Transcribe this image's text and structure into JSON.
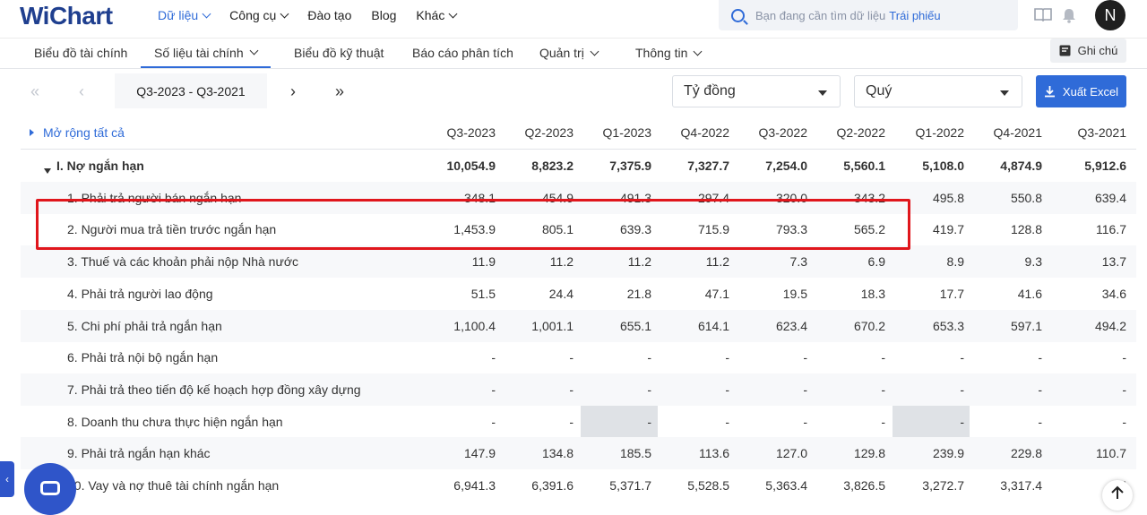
{
  "nav": {
    "logo": "WiChart",
    "items": [
      "Dữ liệu",
      "Công cụ",
      "Đào tạo",
      "Blog",
      "Khác"
    ],
    "search_placeholder": "Bạn đang cần tìm dữ liệu",
    "search_highlight": "Trái phiếu",
    "avatar_letter": "N"
  },
  "subtabs": [
    "Biểu đồ tài chính",
    "Số liệu tài chính",
    "Biểu đồ kỹ thuật",
    "Báo cáo phân tích",
    "Quản trị",
    "Thông tin"
  ],
  "note_label": "Ghi chú",
  "filters": {
    "period_range": "Q3-2023 - Q3-2021",
    "unit": "Tỷ đồng",
    "frequency": "Quý",
    "export_label": "Xuất Excel"
  },
  "table": {
    "expand_all": "Mở rộng tất cả",
    "columns": [
      "Q3-2023",
      "Q2-2023",
      "Q1-2023",
      "Q4-2022",
      "Q3-2022",
      "Q2-2022",
      "Q1-2022",
      "Q4-2021",
      "Q3-2021"
    ],
    "rows": [
      {
        "label": "I. Nợ ngắn hạn",
        "values": [
          "10,054.9",
          "8,823.2",
          "7,375.9",
          "7,327.7",
          "7,254.0",
          "5,560.1",
          "5,108.0",
          "4,874.9",
          "5,912.6"
        ]
      },
      {
        "label": "1. Phải trả người bán ngắn hạn",
        "values": [
          "348.1",
          "454.9",
          "491.3",
          "297.4",
          "320.0",
          "343.2",
          "495.8",
          "550.8",
          "639.4"
        ]
      },
      {
        "label": "2. Người mua trả tiền trước ngắn hạn",
        "values": [
          "1,453.9",
          "805.1",
          "639.3",
          "715.9",
          "793.3",
          "565.2",
          "419.7",
          "128.8",
          "116.7"
        ]
      },
      {
        "label": "3. Thuế và các khoản phải nộp Nhà nước",
        "values": [
          "11.9",
          "11.2",
          "11.2",
          "11.2",
          "7.3",
          "6.9",
          "8.9",
          "9.3",
          "13.7"
        ]
      },
      {
        "label": "4. Phải trả người lao động",
        "values": [
          "51.5",
          "24.4",
          "21.8",
          "47.1",
          "19.5",
          "18.3",
          "17.7",
          "41.6",
          "34.6"
        ]
      },
      {
        "label": "5. Chi phí phải trả ngắn hạn",
        "values": [
          "1,100.4",
          "1,001.1",
          "655.1",
          "614.1",
          "623.4",
          "670.2",
          "653.3",
          "597.1",
          "494.2"
        ]
      },
      {
        "label": "6. Phải trả nội bộ ngắn hạn",
        "values": [
          "-",
          "-",
          "-",
          "-",
          "-",
          "-",
          "-",
          "-",
          "-"
        ]
      },
      {
        "label": "7. Phải trả theo tiến độ kế hoạch hợp đồng xây dựng",
        "values": [
          "-",
          "-",
          "-",
          "-",
          "-",
          "-",
          "-",
          "-",
          "-"
        ]
      },
      {
        "label": "8. Doanh thu chưa thực hiện ngắn hạn",
        "values": [
          "-",
          "-",
          "-",
          "-",
          "-",
          "-",
          "-",
          "-",
          "-"
        ]
      },
      {
        "label": "9. Phải trả ngắn hạn khác",
        "values": [
          "147.9",
          "134.8",
          "185.5",
          "113.6",
          "127.0",
          "129.8",
          "239.9",
          "229.8",
          "110.7"
        ]
      },
      {
        "label": "10. Vay và nợ thuê tài chính ngắn hạn",
        "values": [
          "6,941.3",
          "6,391.6",
          "5,371.7",
          "5,528.5",
          "5,363.4",
          "3,826.5",
          "3,272.7",
          "3,317.4",
          "4,5"
        ]
      }
    ]
  }
}
